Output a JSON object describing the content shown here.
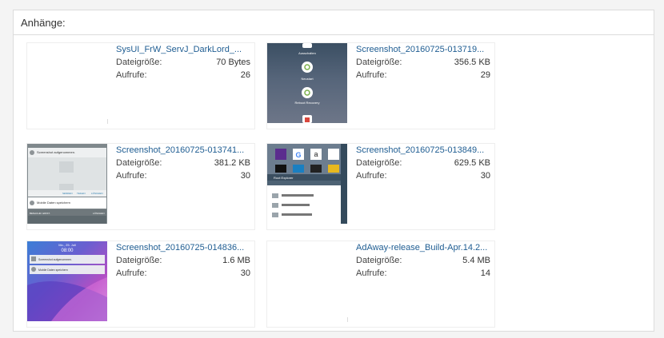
{
  "section_title": "Anhänge:",
  "labels": {
    "size": "Dateigröße:",
    "views": "Aufrufe:"
  },
  "attachments": [
    {
      "name": "SysUI_FrW_ServJ_DarkLord_...",
      "size": "70 Bytes",
      "views": "26",
      "thumb": "blank"
    },
    {
      "name": "Screenshot_20160725-013719...",
      "size": "356.5 KB",
      "views": "29",
      "thumb": "power-menu",
      "texts": [
        "Ausschalten",
        "Neustart",
        "Reboot Recovery"
      ]
    },
    {
      "name": "Screenshot_20160725-013741...",
      "size": "381.2 KB",
      "views": "30",
      "thumb": "notification",
      "texts": [
        "Screenshot aufgenommen.",
        "SENDEN",
        "TEILEN",
        "LÖSCHEN",
        "Mobile Daten speichern",
        "BENACHR. EINST.",
        "LÖSCHEN"
      ]
    },
    {
      "name": "Screenshot_20160725-013849...",
      "size": "629.5 KB",
      "views": "30",
      "thumb": "root-explorer",
      "texts": [
        "Root Explorer"
      ]
    },
    {
      "name": "Screenshot_20160725-014836...",
      "size": "1.6 MB",
      "views": "30",
      "thumb": "lockscreen",
      "texts": [
        "Mo., 25. Juli",
        "08:00",
        "Screenshot aufgenommen.",
        "Mobile Daten speichern"
      ]
    },
    {
      "name": "AdAway-release_Build-Apr.14.2...",
      "size": "5.4 MB",
      "views": "14",
      "thumb": "blank"
    }
  ]
}
